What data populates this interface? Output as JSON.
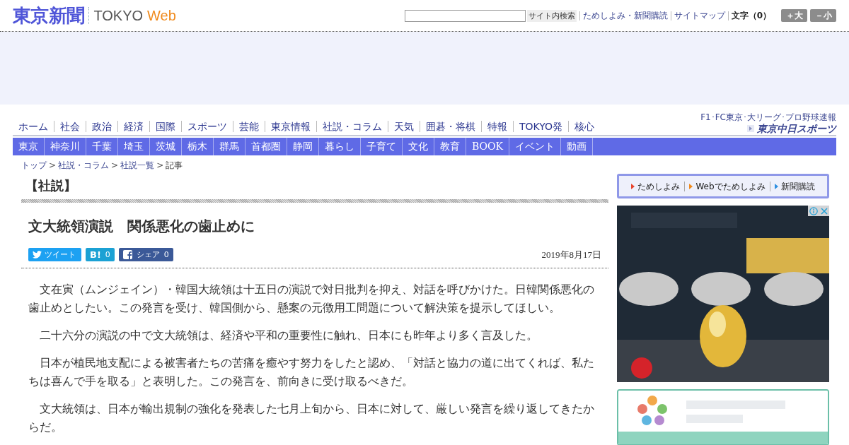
{
  "header": {
    "logo": "東京新聞",
    "brand_tokyo": "TOKYO",
    "brand_web": "Web",
    "search_button": "サイト内検索",
    "links": [
      "ためしよみ・新聞購読",
      "サイトマップ"
    ],
    "font_size_label": "文字（0）",
    "size_buttons": [
      "＋大",
      "－小"
    ]
  },
  "main_nav": [
    "ホーム",
    "社会",
    "政治",
    "経済",
    "国際",
    "スポーツ",
    "芸能",
    "東京情報",
    "社説・コラム",
    "天気",
    "囲碁・将棋",
    "特報",
    "TOKYO発",
    "核心"
  ],
  "sports_link": {
    "caption": "F1･FC東京･大リーグ･プロ野球速報",
    "logo": "東京中日スポーツ"
  },
  "region_nav": [
    "東京",
    "神奈川",
    "千葉",
    "埼玉",
    "茨城",
    "栃木",
    "群馬",
    "首都圏",
    "静岡",
    "暮らし",
    "子育て",
    "文化",
    "教育",
    "BOOK",
    "イベント",
    "動画"
  ],
  "breadcrumb": [
    "トップ",
    "社説・コラム",
    "社説一覧",
    "記事"
  ],
  "breadcrumb_separator": ">",
  "section_title": "【社説】",
  "article": {
    "title": "文大統領演説　関係悪化の歯止めに",
    "share": [
      {
        "kind": "twitter",
        "label": "ツイート"
      },
      {
        "kind": "hatena",
        "label": "B!",
        "count": "0"
      },
      {
        "kind": "facebook",
        "label": "シェア",
        "count": "0"
      }
    ],
    "date": "2019年8月17日",
    "paragraphs": [
      "文在寅（ムンジェイン）・韓国大統領は十五日の演説で対日批判を抑え、対話を呼びかけた。日韓関係悪化の歯止めとしたい。この発言を受け、韓国側から、懸案の元徴用工問題について解決策を提示してほしい。",
      "二十六分の演説の中で文大統領は、経済や平和の重要性に触れ、日本にも昨年より多く言及した。",
      "日本が植民地支配による被害者たちの苦痛を癒やす努力をしたと認め、「対話と協力の道に出てくれば、私たちは喜んで手を取る」と表明した。この発言を、前向きに受け取るべきだ。",
      "文大統領は、日本が輸出規制の強化を発表した七月上旬から、日本に対して、厳しい発言を繰り返してきたからだ。"
    ]
  },
  "sidebar": {
    "subscribe_links": [
      {
        "label": "ためしよみ",
        "color": "#e8452c"
      },
      {
        "label": "Webでためしよみ",
        "color": "#f08a1c"
      },
      {
        "label": "新聞購読",
        "color": "#2f8fe0"
      }
    ]
  }
}
